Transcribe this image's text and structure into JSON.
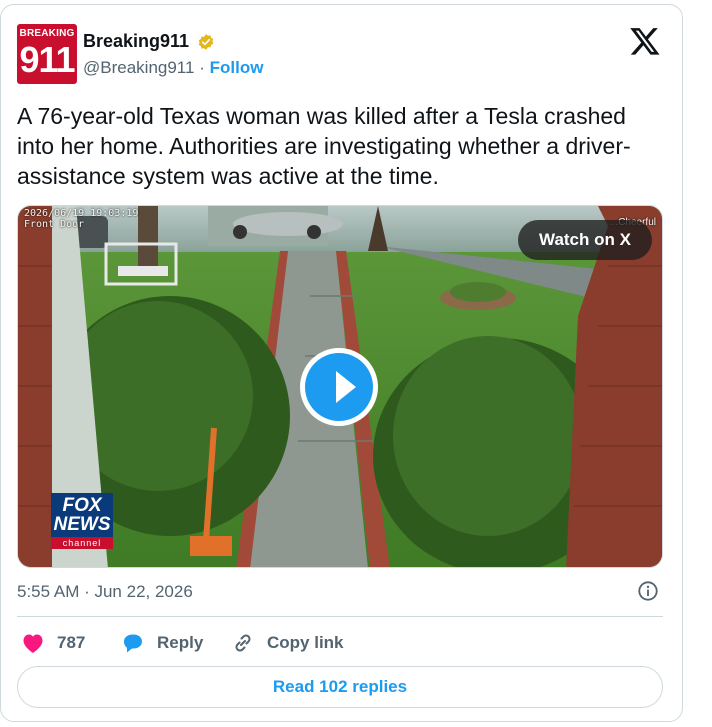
{
  "author": {
    "avatar_text_top": "BREAKING",
    "avatar_text_number": "911",
    "name": "Breaking911",
    "handle": "@Breaking911",
    "separator": "·",
    "follow_label": "Follow"
  },
  "tweet": {
    "text": "A 76-year-old Texas woman was killed after a Tesla crashed into her home. Authorities are investigating whether a driver-assistance system was active at the time."
  },
  "media": {
    "camera_timestamp": "2026/06/19 19:03:19",
    "camera_label": "Front Door",
    "camera_right_text": "...Cheerful",
    "watch_label": "Watch on X",
    "watermark_top": "FOX NEWS",
    "watermark_bottom": "channel"
  },
  "meta": {
    "timestamp": "5:55 AM · Jun 22, 2026"
  },
  "actions": {
    "like_count": "787",
    "reply_label": "Reply",
    "copy_link_label": "Copy link"
  },
  "read_replies_label": "Read 102 replies",
  "colors": {
    "accent": "#1d9bf0",
    "like": "#f91880",
    "brand_red": "#c8102e",
    "muted_text": "#536471"
  },
  "icons": [
    "verified-badge-icon",
    "x-logo-icon",
    "play-icon",
    "info-icon",
    "heart-icon",
    "reply-bubble-icon",
    "link-icon"
  ]
}
